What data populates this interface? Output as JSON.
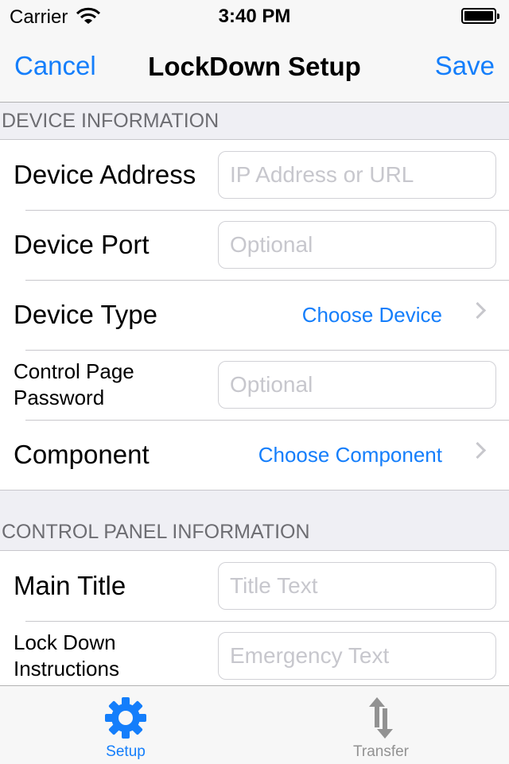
{
  "status_bar": {
    "carrier": "Carrier",
    "time": "3:40 PM"
  },
  "nav": {
    "cancel": "Cancel",
    "title": "LockDown Setup",
    "save": "Save"
  },
  "colors": {
    "accent": "#147efb",
    "placeholder": "#c7c7cd",
    "tab_inactive": "#929292"
  },
  "device_section": {
    "header": "DEVICE INFORMATION",
    "address_label": "Device Address",
    "address_placeholder": "IP Address or URL",
    "port_label": "Device Port",
    "port_placeholder": "Optional",
    "type_label": "Device Type",
    "type_value": "Choose Device",
    "password_label_line1": "Control Page",
    "password_label_line2": "Password",
    "password_placeholder": "Optional",
    "component_label": "Component",
    "component_value": "Choose Component"
  },
  "panel_section": {
    "header": "CONTROL PANEL INFORMATION",
    "title_label": "Main Title",
    "title_placeholder": "Title Text",
    "instructions_label_line1": "Lock Down",
    "instructions_label_line2": "Instructions",
    "instructions_placeholder": "Emergency Text"
  },
  "tabs": [
    {
      "label": "Setup",
      "icon": "gear-icon",
      "selected": true
    },
    {
      "label": "Transfer",
      "icon": "transfer-arrows-icon",
      "selected": false
    }
  ]
}
